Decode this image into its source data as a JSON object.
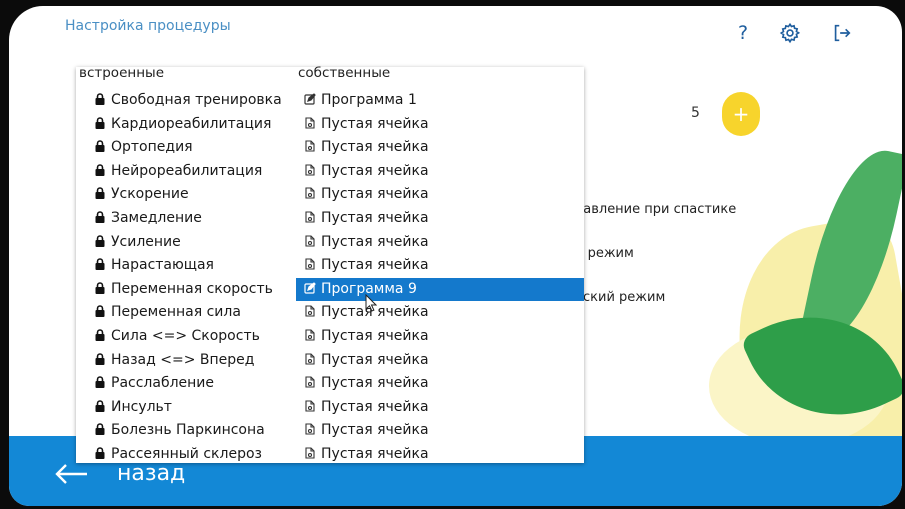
{
  "header": {
    "title": "Настройка процедуры",
    "help_glyph": "?"
  },
  "background": {
    "step_value": "5",
    "plus_glyph": "+",
    "items": [
      "равление при спастике",
      "й режим",
      "еский режим"
    ]
  },
  "popup": {
    "col_builtin_label": "встроенные",
    "col_own_label": "собственные",
    "builtin": [
      "Свободная тренировка",
      "Кардиореабилитация",
      "Ортопедия",
      "Нейрореабилитация",
      "Ускорение",
      "Замедление",
      "Усиление",
      "Нарастающая",
      "Переменная скорость",
      "Переменная сила",
      "Сила  <=> Скорость",
      "Назад <=> Вперед",
      "Расслабление",
      "Инсульт",
      "Болезнь Паркинсона",
      "Рассеянный склероз"
    ],
    "own": [
      "Программа 1",
      "Пустая ячейка",
      "Пустая ячейка",
      "Пустая ячейка",
      "Пустая ячейка",
      "Пустая ячейка",
      "Пустая ячейка",
      "Пустая ячейка",
      "Программа 9",
      "Пустая ячейка",
      "Пустая ячейка",
      "Пустая ячейка",
      "Пустая ячейка",
      "Пустая ячейка",
      "Пустая ячейка",
      "Пустая ячейка"
    ],
    "own_icons": [
      "edit-icon",
      "file-icon",
      "file-icon",
      "file-icon",
      "file-icon",
      "file-icon",
      "file-icon",
      "file-icon",
      "edit-icon",
      "file-icon",
      "file-icon",
      "file-icon",
      "file-icon",
      "file-icon",
      "file-icon",
      "file-icon"
    ],
    "selected_own_index": 8
  },
  "footer": {
    "back_label": "назад"
  },
  "colors": {
    "accent_blue": "#1479cc",
    "bar_blue": "#1388d6",
    "plus_yellow": "#f7d42c",
    "title_blue": "#4a8fc4"
  }
}
